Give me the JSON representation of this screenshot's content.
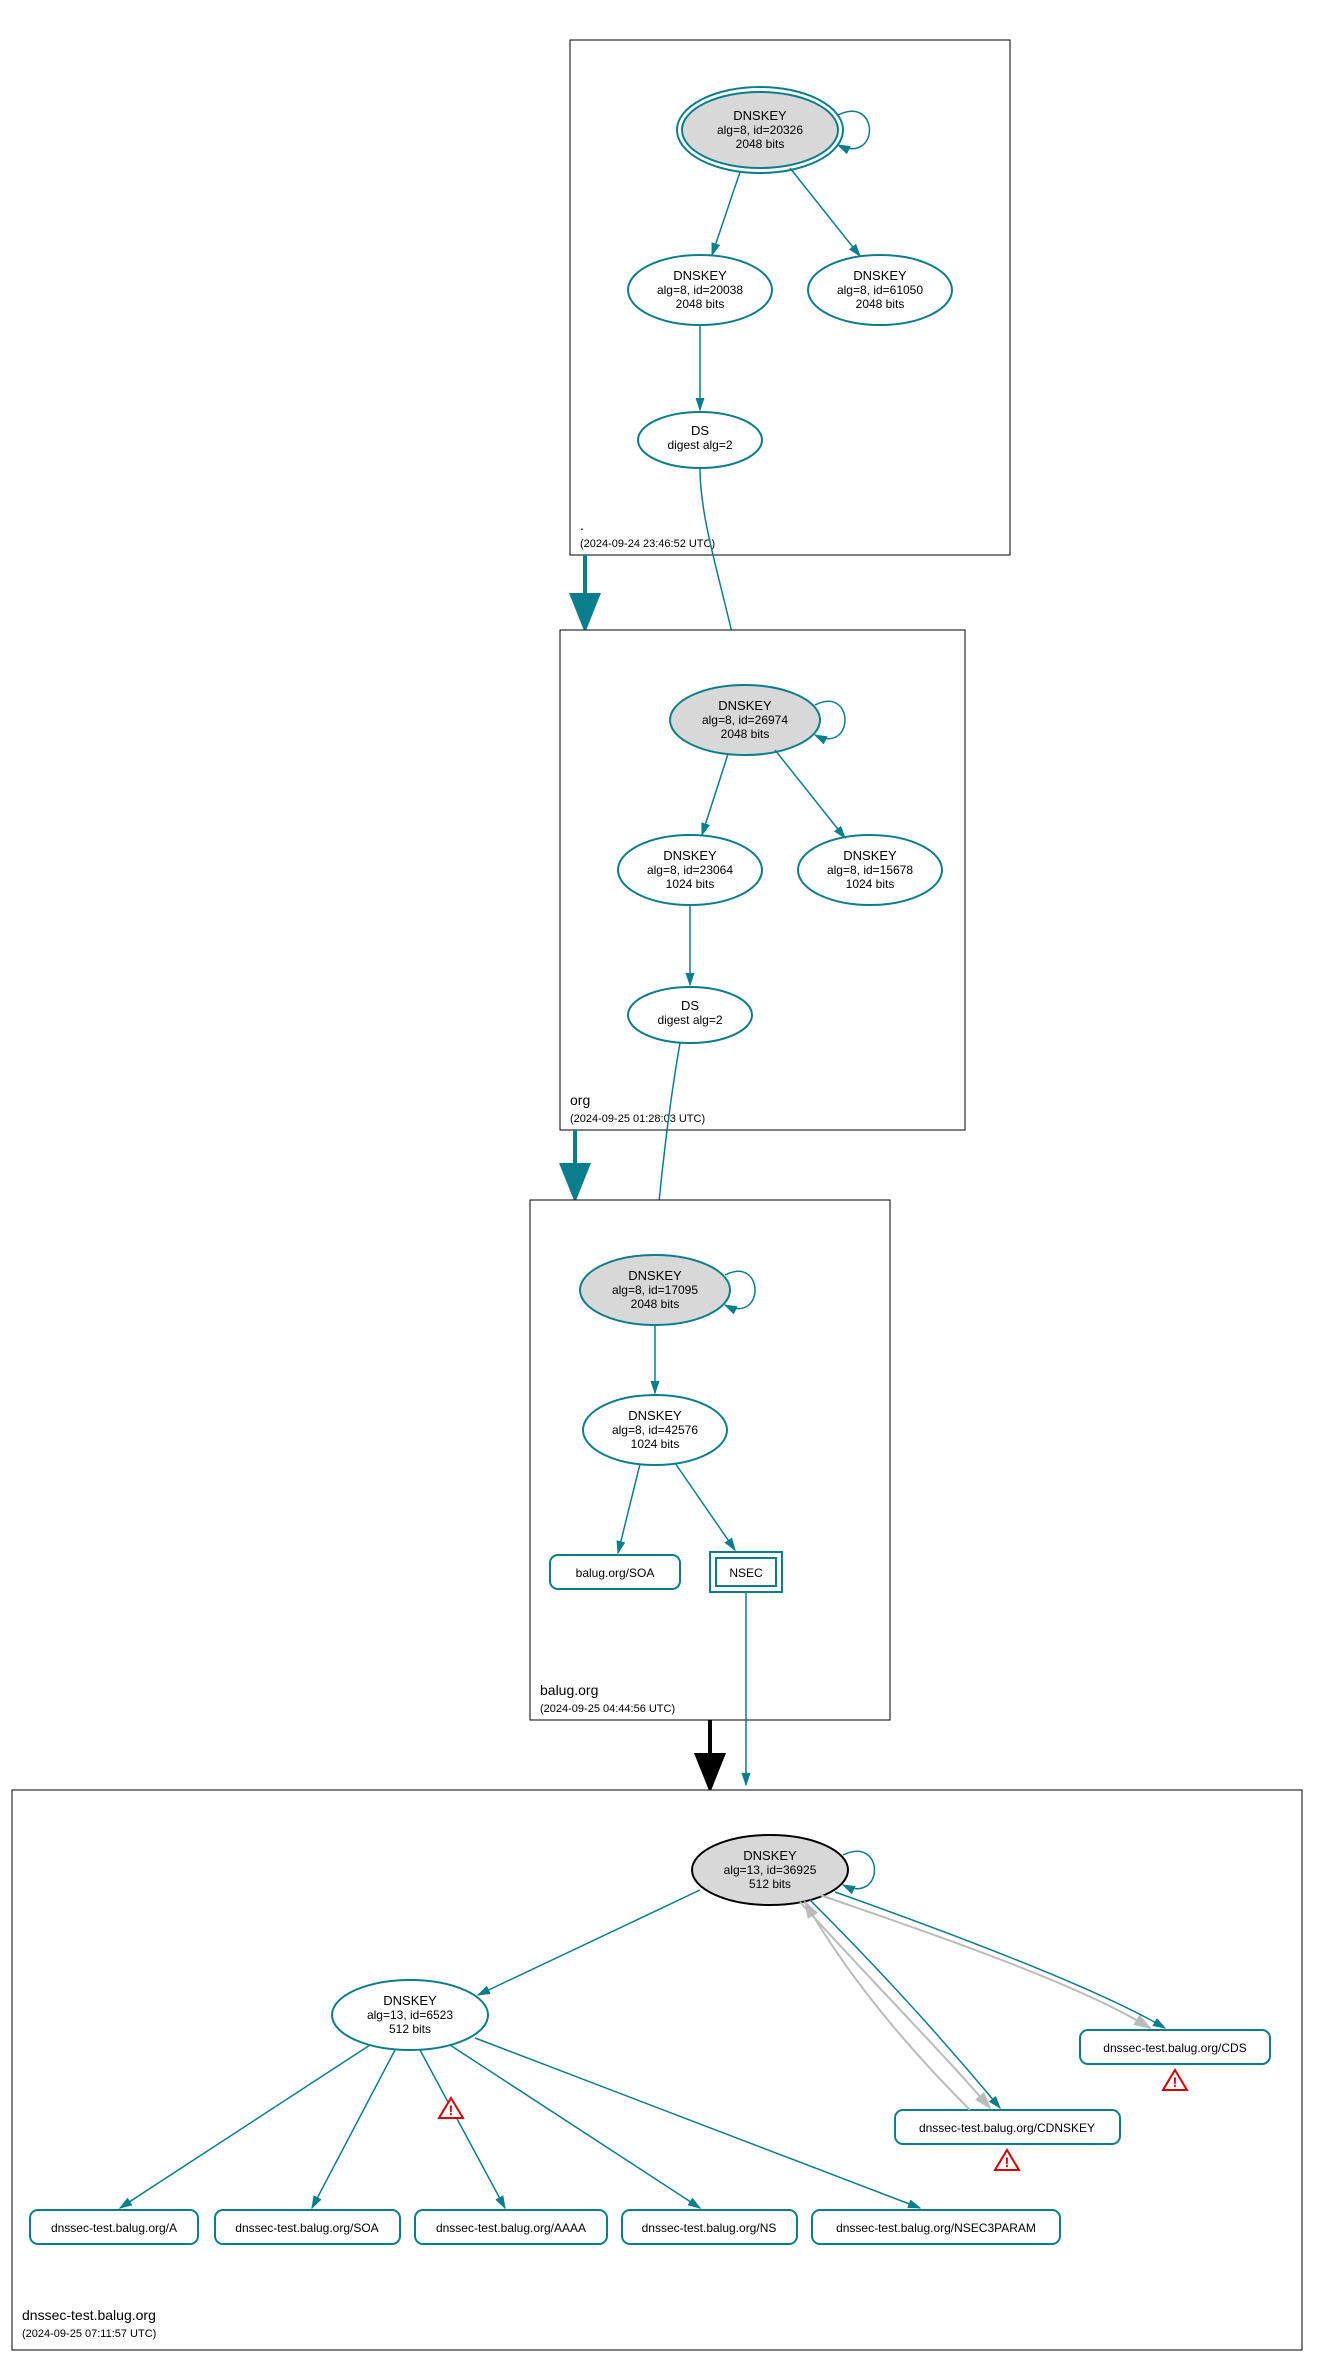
{
  "zones": {
    "root": {
      "label": ".",
      "ts": "(2024-09-24 23:46:52 UTC)"
    },
    "org": {
      "label": "org",
      "ts": "(2024-09-25 01:28:03 UTC)"
    },
    "balug": {
      "label": "balug.org",
      "ts": "(2024-09-25 04:44:56 UTC)"
    },
    "dnssec": {
      "label": "dnssec-test.balug.org",
      "ts": "(2024-09-25 07:11:57 UTC)"
    }
  },
  "nodes": {
    "root_ksk": {
      "l1": "DNSKEY",
      "l2": "alg=8, id=20326",
      "l3": "2048 bits"
    },
    "root_zsk1": {
      "l1": "DNSKEY",
      "l2": "alg=8, id=20038",
      "l3": "2048 bits"
    },
    "root_zsk2": {
      "l1": "DNSKEY",
      "l2": "alg=8, id=61050",
      "l3": "2048 bits"
    },
    "root_ds": {
      "l1": "DS",
      "l2": "digest alg=2"
    },
    "org_ksk": {
      "l1": "DNSKEY",
      "l2": "alg=8, id=26974",
      "l3": "2048 bits"
    },
    "org_zsk1": {
      "l1": "DNSKEY",
      "l2": "alg=8, id=23064",
      "l3": "1024 bits"
    },
    "org_zsk2": {
      "l1": "DNSKEY",
      "l2": "alg=8, id=15678",
      "l3": "1024 bits"
    },
    "org_ds": {
      "l1": "DS",
      "l2": "digest alg=2"
    },
    "balug_ksk": {
      "l1": "DNSKEY",
      "l2": "alg=8, id=17095",
      "l3": "2048 bits"
    },
    "balug_zsk": {
      "l1": "DNSKEY",
      "l2": "alg=8, id=42576",
      "l3": "1024 bits"
    },
    "balug_soa": {
      "l1": "balug.org/SOA"
    },
    "balug_nsec": {
      "l1": "NSEC"
    },
    "dns_ksk": {
      "l1": "DNSKEY",
      "l2": "alg=13, id=36925",
      "l3": "512 bits"
    },
    "dns_zsk": {
      "l1": "DNSKEY",
      "l2": "alg=13, id=6523",
      "l3": "512 bits"
    },
    "leaf_a": {
      "l1": "dnssec-test.balug.org/A"
    },
    "leaf_soa": {
      "l1": "dnssec-test.balug.org/SOA"
    },
    "leaf_aaaa": {
      "l1": "dnssec-test.balug.org/AAAA"
    },
    "leaf_ns": {
      "l1": "dnssec-test.balug.org/NS"
    },
    "leaf_n3p": {
      "l1": "dnssec-test.balug.org/NSEC3PARAM"
    },
    "leaf_cdnskey": {
      "l1": "dnssec-test.balug.org/CDNSKEY"
    },
    "leaf_cds": {
      "l1": "dnssec-test.balug.org/CDS"
    }
  }
}
